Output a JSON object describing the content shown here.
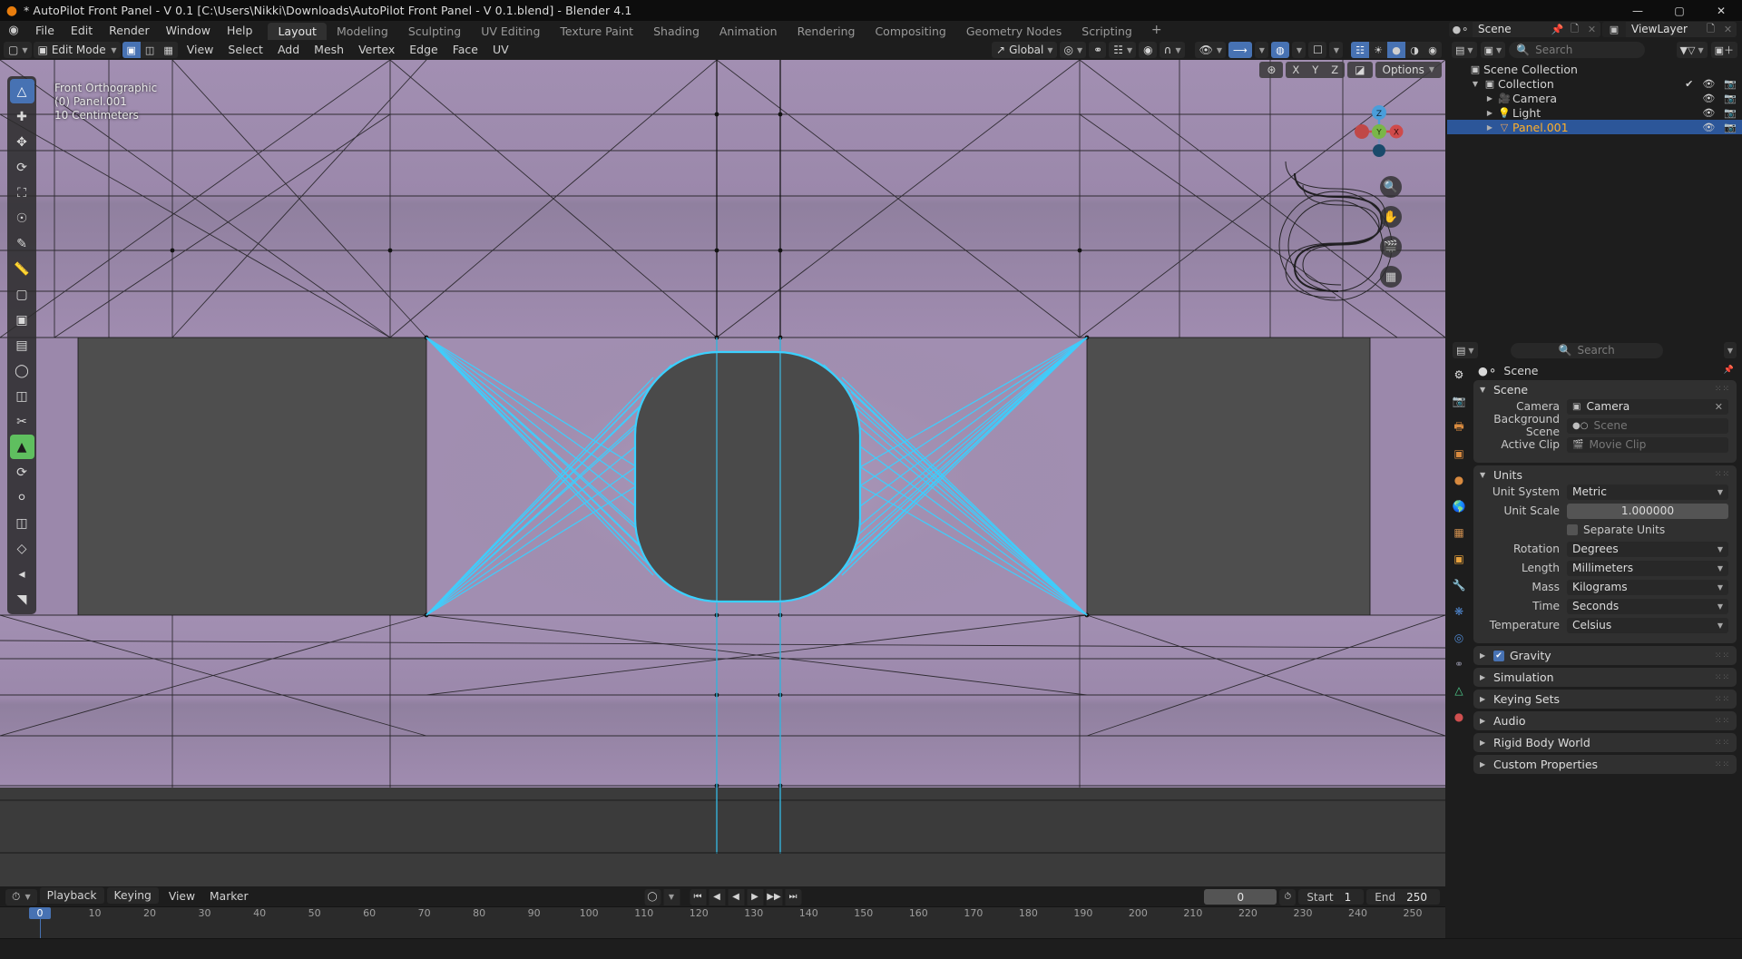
{
  "window": {
    "title": "* AutoPilot Front Panel - V 0.1 [C:\\Users\\Nikki\\Downloads\\AutoPilot Front Panel - V 0.1.blend] - Blender 4.1",
    "minimize": "—",
    "maximize": "▢",
    "close": "✕"
  },
  "menubar": {
    "items": [
      "File",
      "Edit",
      "Render",
      "Window",
      "Help"
    ],
    "workspaces": [
      {
        "label": "Layout",
        "active": true
      },
      {
        "label": "Modeling",
        "active": false
      },
      {
        "label": "Sculpting",
        "active": false
      },
      {
        "label": "UV Editing",
        "active": false
      },
      {
        "label": "Texture Paint",
        "active": false
      },
      {
        "label": "Shading",
        "active": false
      },
      {
        "label": "Animation",
        "active": false
      },
      {
        "label": "Rendering",
        "active": false
      },
      {
        "label": "Compositing",
        "active": false
      },
      {
        "label": "Geometry Nodes",
        "active": false
      },
      {
        "label": "Scripting",
        "active": false
      }
    ],
    "add_workspace": "+"
  },
  "scene_selector": {
    "scene_name": "Scene",
    "viewlayer_name": "ViewLayer",
    "pin_icon": "pin-icon",
    "copy_icon": "copy-icon",
    "close_icon": "✕"
  },
  "viewport": {
    "mode": "Edit Mode",
    "menus": [
      "View",
      "Select",
      "Add",
      "Mesh",
      "Vertex",
      "Edge",
      "Face",
      "UV"
    ],
    "transform_orientation": "Global",
    "options_label": "Options",
    "axis_buttons": [
      "X",
      "Y",
      "Z"
    ],
    "overlay": {
      "view_name": "Front Orthographic",
      "object_name": "(0) Panel.001",
      "grid_scale": "10 Centimeters"
    },
    "gizmo_axes": {
      "z": "Z",
      "y": "Y",
      "x": "X"
    },
    "select_modes": [
      "vertex-select",
      "edge-select",
      "face-select"
    ],
    "shading_modes": [
      "wireframe",
      "solid",
      "material-preview",
      "rendered"
    ],
    "accent_color": "#4772b3",
    "mesh_color": "#a08cb0",
    "selection_color": "#3bd0ff"
  },
  "outliner": {
    "search_placeholder": "Search",
    "rows": [
      {
        "label": "Scene Collection",
        "icon": "collection-icon",
        "depth": 0,
        "selected": false,
        "expandable": false,
        "show_toggles": false
      },
      {
        "label": "Collection",
        "icon": "collection-icon",
        "depth": 1,
        "selected": false,
        "expandable": true,
        "expanded": true,
        "show_toggles": true
      },
      {
        "label": "Camera",
        "icon": "camera-icon",
        "depth": 2,
        "selected": false,
        "expandable": true,
        "expanded": false,
        "show_toggles": true
      },
      {
        "label": "Light",
        "icon": "light-icon",
        "depth": 2,
        "selected": false,
        "expandable": true,
        "expanded": false,
        "show_toggles": true
      },
      {
        "label": "Panel.001",
        "icon": "mesh-icon",
        "depth": 2,
        "selected": true,
        "expandable": true,
        "expanded": false,
        "show_toggles": true
      }
    ]
  },
  "properties": {
    "search_placeholder": "Search",
    "breadcrumb": "Scene",
    "panels": [
      {
        "name": "Scene",
        "open": true,
        "fields": [
          {
            "label": "Camera",
            "value": "Camera",
            "type": "id",
            "icon": "camera-data-icon",
            "clear": true
          },
          {
            "label": "Background Scene",
            "value": "Scene",
            "type": "id",
            "icon": "scene-icon",
            "placeholder": true
          },
          {
            "label": "Active Clip",
            "value": "Movie Clip",
            "type": "id",
            "icon": "clip-icon",
            "placeholder": true
          }
        ]
      },
      {
        "name": "Units",
        "open": true,
        "fields": [
          {
            "label": "Unit System",
            "value": "Metric",
            "type": "dropdown"
          },
          {
            "label": "Unit Scale",
            "value": "1.000000",
            "type": "number"
          },
          {
            "label": "",
            "value": "Separate Units",
            "type": "checkbox",
            "checked": false
          },
          {
            "label": "Rotation",
            "value": "Degrees",
            "type": "dropdown"
          },
          {
            "label": "Length",
            "value": "Millimeters",
            "type": "dropdown"
          },
          {
            "label": "Mass",
            "value": "Kilograms",
            "type": "dropdown"
          },
          {
            "label": "Time",
            "value": "Seconds",
            "type": "dropdown"
          },
          {
            "label": "Temperature",
            "value": "Celsius",
            "type": "dropdown"
          }
        ]
      }
    ],
    "collapsed_panels": [
      {
        "name": "Gravity",
        "checkbox": true,
        "checked": true
      },
      {
        "name": "Simulation",
        "checkbox": false
      },
      {
        "name": "Keying Sets",
        "checkbox": false
      },
      {
        "name": "Audio",
        "checkbox": false
      },
      {
        "name": "Rigid Body World",
        "checkbox": false
      },
      {
        "name": "Custom Properties",
        "checkbox": false
      }
    ]
  },
  "timeline": {
    "menus": [
      "Playback",
      "Keying",
      "View",
      "Marker"
    ],
    "current_frame": "0",
    "start_label": "Start",
    "start_value": "1",
    "end_label": "End",
    "end_value": "250",
    "ruler_ticks": [
      0,
      10,
      20,
      30,
      40,
      50,
      60,
      70,
      80,
      90,
      100,
      110,
      120,
      130,
      140,
      150,
      160,
      170,
      180,
      190,
      200,
      210,
      220,
      230,
      240,
      250
    ],
    "playhead_frame": "0"
  }
}
